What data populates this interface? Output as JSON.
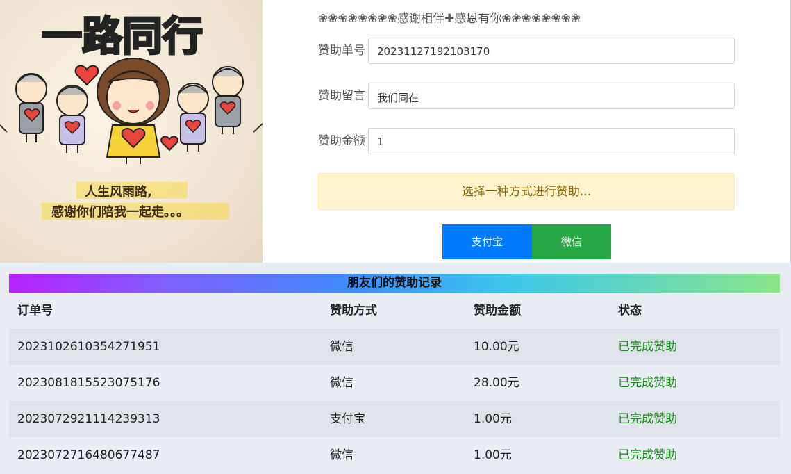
{
  "poster": {
    "title_line": "一路同行",
    "caption_line1": "人生风雨路,",
    "caption_line2": "感谢你们陪我一起走。。。"
  },
  "header": {
    "flowers_text": "❀❀❀❀❀❀❀❀感谢相伴✚感恩有你❀❀❀❀❀❀❀❀"
  },
  "form": {
    "order_label": "赞助单号",
    "order_value": "20231127192103170",
    "message_label": "赞助留言",
    "message_value": "我们同在",
    "amount_label": "赞助金额",
    "amount_value": "1",
    "notice": "选择一种方式进行赞助..."
  },
  "buttons": {
    "alipay": "支付宝",
    "wechat": "微信"
  },
  "records": {
    "title": "朋友们的赞助记录",
    "headers": [
      "订单号",
      "赞助方式",
      "赞助金额",
      "状态"
    ],
    "rows": [
      [
        "2023102610354271951",
        "微信",
        "10.00元",
        "已完成赞助"
      ],
      [
        "2023081815523075176",
        "微信",
        "28.00元",
        "已完成赞助"
      ],
      [
        "2023072921114239313",
        "支付宝",
        "1.00元",
        "已完成赞助"
      ],
      [
        "2023072716480677487",
        "微信",
        "1.00元",
        "已完成赞助"
      ]
    ]
  },
  "colors": {
    "alipay_blue": "#007bff",
    "wechat_green": "#28a745",
    "notice_bg": "#fff3cd",
    "status_green": "#1a8a1a"
  }
}
